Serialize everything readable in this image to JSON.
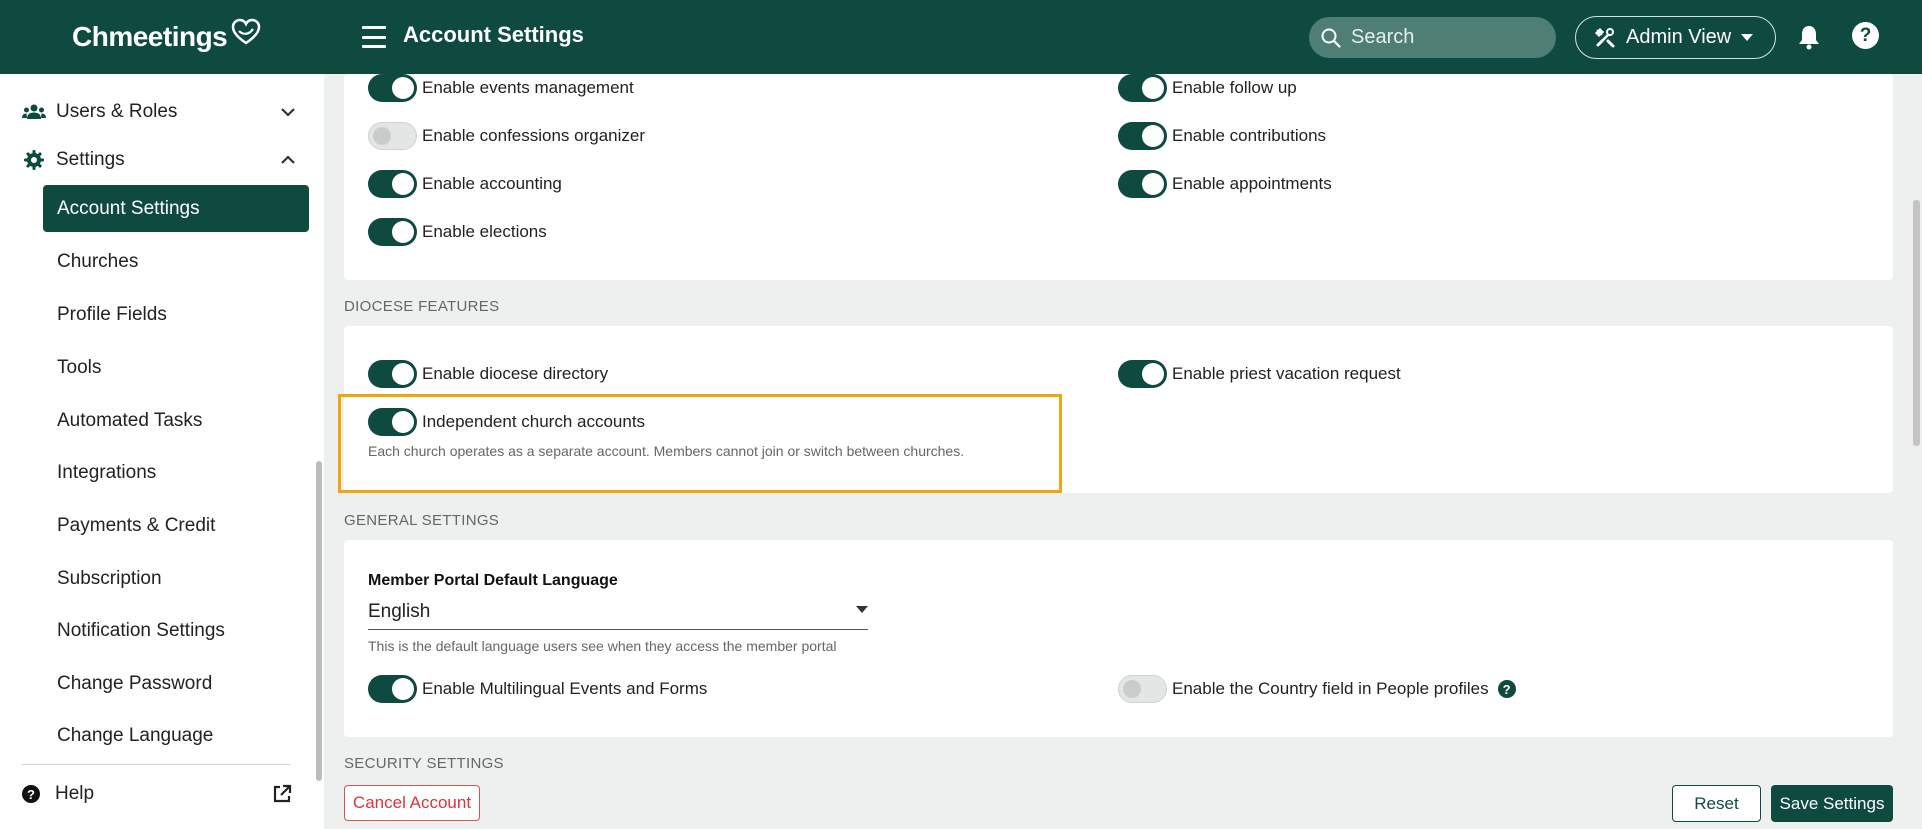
{
  "header": {
    "logo_text": "Chmeetings",
    "title": "Account Settings",
    "search_placeholder": "Search",
    "admin_view_label": "Admin View",
    "help_icon_text": "?"
  },
  "sidebar": {
    "users_roles": "Users & Roles",
    "settings": "Settings",
    "items": [
      "Account Settings",
      "Churches",
      "Profile Fields",
      "Tools",
      "Automated Tasks",
      "Integrations",
      "Payments & Credit",
      "Subscription",
      "Notification Settings",
      "Change Password",
      "Change Language"
    ],
    "active_item": "Account Settings",
    "help": "Help",
    "help_icon_text": "?"
  },
  "features": {
    "events": "Enable events management",
    "follow_up": "Enable follow up",
    "confessions": "Enable confessions organizer",
    "contributions": "Enable contributions",
    "accounting": "Enable accounting",
    "appointments": "Enable appointments",
    "elections": "Enable elections"
  },
  "diocese": {
    "section_title": "DIOCESE FEATURES",
    "directory": "Enable diocese directory",
    "vacation": "Enable priest vacation request",
    "independent": "Independent church accounts",
    "independent_desc": "Each church operates as a separate account. Members cannot join or switch between churches."
  },
  "general": {
    "section_title": "GENERAL SETTINGS",
    "language_label": "Member Portal Default Language",
    "language_value": "English",
    "language_help": "This is the default language users see when they access the member portal",
    "multilingual": "Enable Multilingual Events and Forms",
    "country_field": "Enable the Country field in People profiles",
    "country_help_icon": "?"
  },
  "security": {
    "section_title": "SECURITY SETTINGS"
  },
  "actions": {
    "cancel_account": "Cancel Account",
    "reset": "Reset",
    "save": "Save Settings"
  },
  "colors": {
    "brand": "#0f4a40",
    "highlight": "#f0a60f",
    "danger": "#d9343a"
  }
}
